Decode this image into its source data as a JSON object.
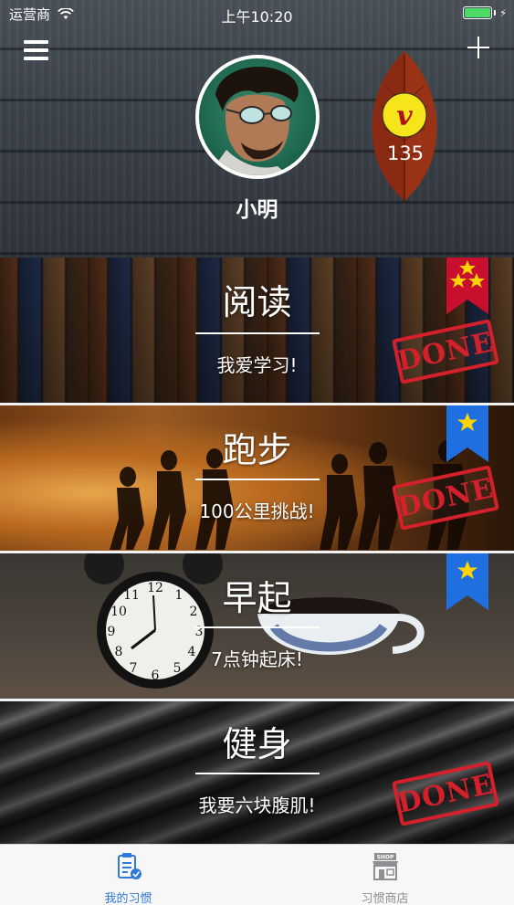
{
  "status_bar": {
    "carrier": "运营商",
    "time": "上午10:20"
  },
  "header": {
    "menu_icon": "hamburger-menu-icon",
    "add_icon": "plus-icon",
    "user_name": "小明",
    "points": "135",
    "points_badge_letter": "v"
  },
  "habits": [
    {
      "title": "阅读",
      "subtitle": "我爱学习!",
      "done": true,
      "done_label": "DONE",
      "stars": 3,
      "ribbon_color": "#c8102e"
    },
    {
      "title": "跑步",
      "subtitle": "100公里挑战!",
      "done": true,
      "done_label": "DONE",
      "stars": 1,
      "ribbon_color": "#1f6fe0"
    },
    {
      "title": "早起",
      "subtitle": "7点钟起床!",
      "done": false,
      "done_label": "",
      "stars": 1,
      "ribbon_color": "#1f6fe0"
    },
    {
      "title": "健身",
      "subtitle": "我要六块腹肌!",
      "done": true,
      "done_label": "DONE",
      "stars": 0,
      "ribbon_color": ""
    }
  ],
  "tabbar": {
    "tabs": [
      {
        "label": "我的习惯",
        "icon": "habit-list-icon",
        "active": true
      },
      {
        "label": "习惯商店",
        "icon": "shop-icon",
        "active": false,
        "icon_text": "SHOP"
      }
    ],
    "accent": "#2f7ad6"
  }
}
